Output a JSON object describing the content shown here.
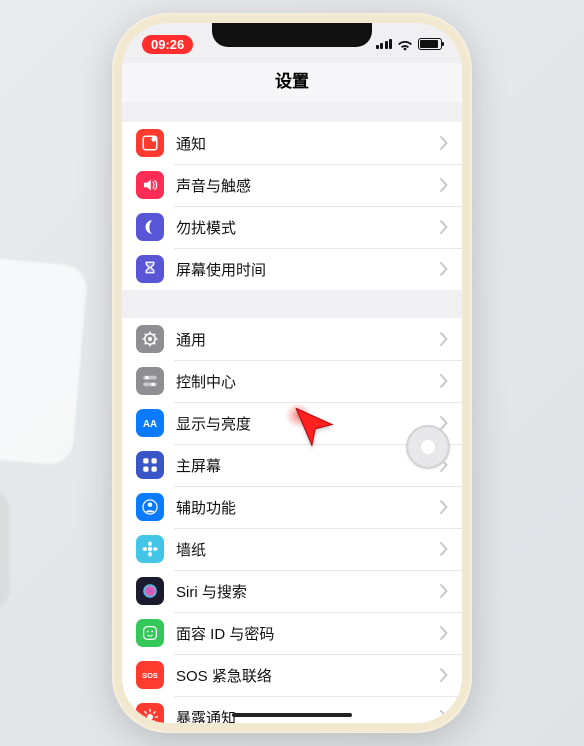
{
  "status": {
    "time": "09:26"
  },
  "nav": {
    "title": "设置"
  },
  "groups": [
    {
      "rows": [
        {
          "name": "notifications",
          "label": "通知",
          "icon": "notifications",
          "bg": "#ff3b30"
        },
        {
          "name": "sounds",
          "label": "声音与触感",
          "icon": "speaker",
          "bg": "#ff2d55"
        },
        {
          "name": "dnd",
          "label": "勿扰模式",
          "icon": "moon",
          "bg": "#5856d6"
        },
        {
          "name": "screentime",
          "label": "屏幕使用时间",
          "icon": "hourglass",
          "bg": "#5856d6"
        }
      ]
    },
    {
      "rows": [
        {
          "name": "general",
          "label": "通用",
          "icon": "gear",
          "bg": "#8e8e93"
        },
        {
          "name": "control",
          "label": "控制中心",
          "icon": "switches",
          "bg": "#8e8e93"
        },
        {
          "name": "display",
          "label": "显示与亮度",
          "icon": "aa",
          "bg": "#0a7aff"
        },
        {
          "name": "home",
          "label": "主屏幕",
          "icon": "grid",
          "bg": "#3955c6"
        },
        {
          "name": "accessibility",
          "label": "辅助功能",
          "icon": "person",
          "bg": "#0a7aff"
        },
        {
          "name": "wallpaper",
          "label": "墙纸",
          "icon": "flower",
          "bg": "#43c5e8"
        },
        {
          "name": "siri",
          "label": "Siri 与搜索",
          "icon": "siri",
          "bg": "#1b1b2e"
        },
        {
          "name": "faceid",
          "label": "面容 ID 与密码",
          "icon": "face",
          "bg": "#34c759"
        },
        {
          "name": "sos",
          "label": "SOS 紧急联络",
          "icon": "sos",
          "bg": "#ff3b30"
        },
        {
          "name": "exposure",
          "label": "暴露通知",
          "icon": "exposure",
          "bg": "#ff3b30"
        }
      ]
    }
  ]
}
